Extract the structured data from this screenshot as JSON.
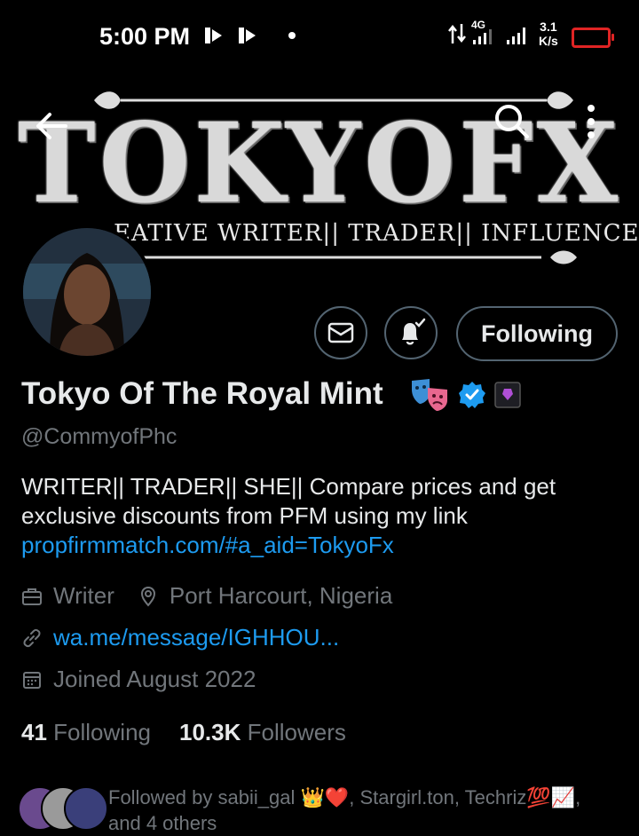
{
  "status_bar": {
    "time": "5:00 PM",
    "network_type": "4G",
    "speed_value": "3.1",
    "speed_unit": "K/s"
  },
  "banner": {
    "title": "TOKYOFX",
    "subtitle": "EATIVE WRITER|| TRADER|| INFLUENCER"
  },
  "profile": {
    "display_name": "Tokyo Of The Royal Mint",
    "handle": "@CommyofPhc",
    "bio_text": "WRITER|| TRADER|| SHE||  Compare prices and get exclusive discounts from PFM using my link",
    "bio_link": "propfirmmatch.com/#a_aid=TokyoFx",
    "profession": "Writer",
    "location": "Port Harcourt, Nigeria",
    "website": "wa.me/message/IGHHOU...",
    "joined": "Joined August 2022"
  },
  "actions": {
    "following_label": "Following"
  },
  "stats": {
    "following_count": "41",
    "following_label": "Following",
    "followers_count": "10.3K",
    "followers_label": "Followers"
  },
  "followed_by": {
    "text": "Followed by sabii_gal 👑❤️, Stargirl.ton, Techriz💯📈, and 4 others"
  },
  "colors": {
    "background": "#000000",
    "accent": "#1d9bf0",
    "secondary_text": "#71767b",
    "primary_text": "#e7e9ea",
    "border": "#536471",
    "battery": "#e02424"
  },
  "icons": {
    "back": "arrow-left-icon",
    "search": "search-icon",
    "more": "more-vertical-icon",
    "message": "envelope-icon",
    "notify": "bell-check-icon",
    "profession": "briefcase-icon",
    "location": "pin-icon",
    "website": "link-icon",
    "joined": "calendar-icon",
    "verified": "verified-badge-icon"
  }
}
